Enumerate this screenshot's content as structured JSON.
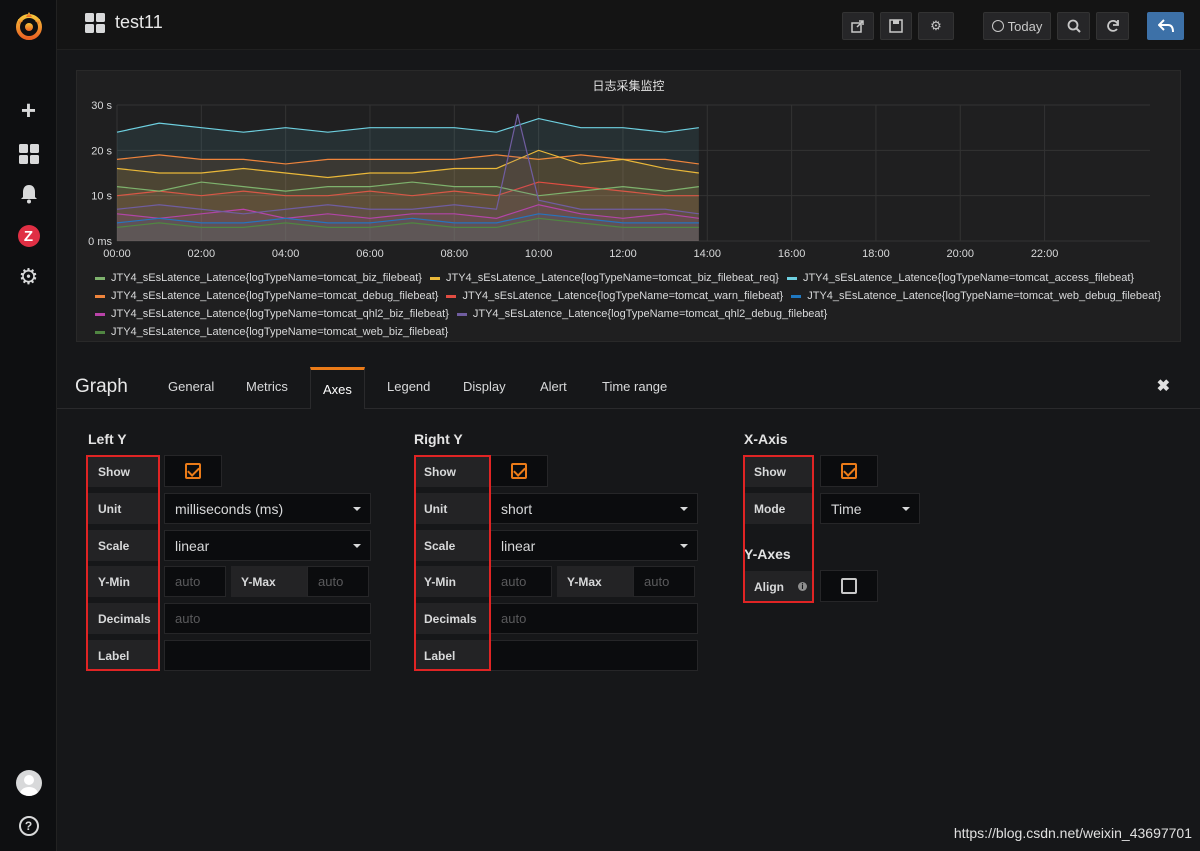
{
  "sidebar": {
    "items": [
      "logo-icon",
      "plus-icon",
      "dashboards-icon",
      "bell-icon",
      "zabbix-icon",
      "gear-icon",
      "avatar",
      "help-icon"
    ]
  },
  "topnav": {
    "dashboard_title": "test11",
    "today_label": "Today",
    "buttons": [
      "share-icon",
      "save-icon",
      "settings-icon",
      "clock-icon",
      "zoom-out-icon",
      "refresh-icon",
      "back-icon"
    ]
  },
  "panel": {
    "title": "日志采集监控",
    "legend": [
      "JTY4_sEsLatence_Latence{logTypeName=tomcat_biz_filebeat}",
      "JTY4_sEsLatence_Latence{logTypeName=tomcat_biz_filebeat_req}",
      "JTY4_sEsLatence_Latence{logTypeName=tomcat_access_filebeat}",
      "JTY4_sEsLatence_Latence{logTypeName=tomcat_debug_filebeat}",
      "JTY4_sEsLatence_Latence{logTypeName=tomcat_warn_filebeat}",
      "JTY4_sEsLatence_Latence{logTypeName=tomcat_web_debug_filebeat}",
      "JTY4_sEsLatence_Latence{logTypeName=tomcat_qhl2_biz_filebeat}",
      "JTY4_sEsLatence_Latence{logTypeName=tomcat_qhl2_debug_filebeat}",
      "JTY4_sEsLatence_Latence{logTypeName=tomcat_web_biz_filebeat}"
    ],
    "legend_colors": [
      "#7eb26d",
      "#eab839",
      "#6ed0e0",
      "#ef843c",
      "#e24d42",
      "#1f78c1",
      "#ba43a9",
      "#705da0",
      "#508642"
    ]
  },
  "chart_data": {
    "type": "line",
    "title": "日志采集监控",
    "xlabel": "",
    "ylabel": "",
    "x_ticks": [
      "00:00",
      "02:00",
      "04:00",
      "06:00",
      "08:00",
      "10:00",
      "12:00",
      "14:00",
      "16:00",
      "18:00",
      "20:00",
      "22:00"
    ],
    "y_ticks": [
      "0 ms",
      "10 s",
      "20 s",
      "30 s"
    ],
    "ylim": [
      0,
      30
    ],
    "xlim": [
      0,
      24.5
    ],
    "grid": true,
    "legend_position": "bottom",
    "series": [
      {
        "name": "JTY4_sEsLatence_Latence{logTypeName=tomcat_access_filebeat}",
        "x": [
          0,
          1,
          2,
          3,
          4,
          5,
          6,
          7,
          8,
          9,
          10,
          11,
          12,
          13,
          13.8
        ],
        "values": [
          24,
          26,
          25,
          24,
          25,
          24,
          25,
          25,
          25,
          24,
          27,
          25,
          25,
          24,
          25
        ]
      },
      {
        "name": "JTY4_sEsLatence_Latence{logTypeName=tomcat_debug_filebeat}",
        "x": [
          0,
          1,
          2,
          3,
          4,
          5,
          6,
          7,
          8,
          9,
          10,
          11,
          12,
          13,
          13.8
        ],
        "values": [
          18,
          19,
          18,
          18,
          17,
          18,
          18,
          18,
          18,
          19,
          18,
          19,
          18,
          18,
          17
        ]
      },
      {
        "name": "JTY4_sEsLatence_Latence{logTypeName=tomcat_biz_filebeat_req}",
        "x": [
          0,
          1,
          2,
          3,
          4,
          5,
          6,
          7,
          8,
          9,
          10,
          11,
          12,
          13,
          13.8
        ],
        "values": [
          16,
          15,
          15,
          16,
          15,
          14,
          15,
          15,
          16,
          16,
          20,
          17,
          18,
          16,
          15
        ]
      },
      {
        "name": "JTY4_sEsLatence_Latence{logTypeName=tomcat_warn_filebeat}",
        "x": [
          0,
          1,
          2,
          3,
          4,
          5,
          6,
          7,
          8,
          9,
          10,
          11,
          12,
          13,
          13.8
        ],
        "values": [
          10,
          11,
          10,
          11,
          10,
          10,
          11,
          10,
          11,
          10,
          13,
          12,
          11,
          10,
          10
        ]
      },
      {
        "name": "JTY4_sEsLatence_Latence{logTypeName=tomcat_biz_filebeat}",
        "x": [
          0,
          1,
          2,
          3,
          4,
          5,
          6,
          7,
          8,
          9,
          10,
          11,
          12,
          13,
          13.8
        ],
        "values": [
          12,
          11,
          13,
          12,
          11,
          12,
          12,
          13,
          12,
          12,
          10,
          11,
          12,
          11,
          12
        ]
      },
      {
        "name": "JTY4_sEsLatence_Latence{logTypeName=tomcat_qhl2_biz_filebeat}",
        "x": [
          0,
          1,
          2,
          3,
          4,
          5,
          6,
          7,
          8,
          9,
          10,
          11,
          12,
          13,
          13.8
        ],
        "values": [
          6,
          5,
          6,
          7,
          5,
          6,
          5,
          6,
          6,
          5,
          8,
          6,
          5,
          6,
          5
        ]
      },
      {
        "name": "JTY4_sEsLatence_Latence{logTypeName=tomcat_web_debug_filebeat}",
        "x": [
          0,
          1,
          2,
          3,
          4,
          5,
          6,
          7,
          8,
          9,
          10,
          11,
          12,
          13,
          13.8
        ],
        "values": [
          4,
          5,
          4,
          4,
          5,
          4,
          4,
          5,
          4,
          4,
          6,
          5,
          4,
          4,
          4
        ]
      },
      {
        "name": "JTY4_sEsLatence_Latence{logTypeName=tomcat_qhl2_debug_filebeat}",
        "x": [
          0,
          1,
          2,
          3,
          4,
          5,
          6,
          7,
          8,
          9,
          9.5,
          10,
          11,
          12,
          13,
          13.8
        ],
        "values": [
          7,
          8,
          7,
          6,
          7,
          8,
          7,
          7,
          8,
          7,
          28,
          9,
          7,
          7,
          7,
          6
        ]
      },
      {
        "name": "JTY4_sEsLatence_Latence{logTypeName=tomcat_web_biz_filebeat}",
        "x": [
          0,
          1,
          2,
          3,
          4,
          5,
          6,
          7,
          8,
          9,
          10,
          11,
          12,
          13,
          13.8
        ],
        "values": [
          3,
          4,
          3,
          3,
          4,
          3,
          3,
          4,
          3,
          3,
          5,
          4,
          3,
          3,
          3
        ]
      }
    ]
  },
  "editor": {
    "title": "Graph",
    "tabs": [
      "General",
      "Metrics",
      "Axes",
      "Legend",
      "Display",
      "Alert",
      "Time range"
    ],
    "active_tab": "Axes",
    "left_y": {
      "heading": "Left Y",
      "show_label": "Show",
      "unit_label": "Unit",
      "unit_value": "milliseconds (ms)",
      "scale_label": "Scale",
      "scale_value": "linear",
      "ymin_label": "Y-Min",
      "ymin_placeholder": "auto",
      "ymax_label": "Y-Max",
      "ymax_placeholder": "auto",
      "decimals_label": "Decimals",
      "decimals_placeholder": "auto",
      "label_label": "Label"
    },
    "right_y": {
      "heading": "Right Y",
      "show_label": "Show",
      "unit_label": "Unit",
      "unit_value": "short",
      "scale_label": "Scale",
      "scale_value": "linear",
      "ymin_label": "Y-Min",
      "ymin_placeholder": "auto",
      "ymax_label": "Y-Max",
      "ymax_placeholder": "auto",
      "decimals_label": "Decimals",
      "decimals_placeholder": "auto",
      "label_label": "Label"
    },
    "x_axis": {
      "heading": "X-Axis",
      "show_label": "Show",
      "mode_label": "Mode",
      "mode_value": "Time"
    },
    "y_axes": {
      "heading": "Y-Axes",
      "align_label": "Align"
    }
  },
  "watermark": "https://blog.csdn.net/weixin_43697701"
}
